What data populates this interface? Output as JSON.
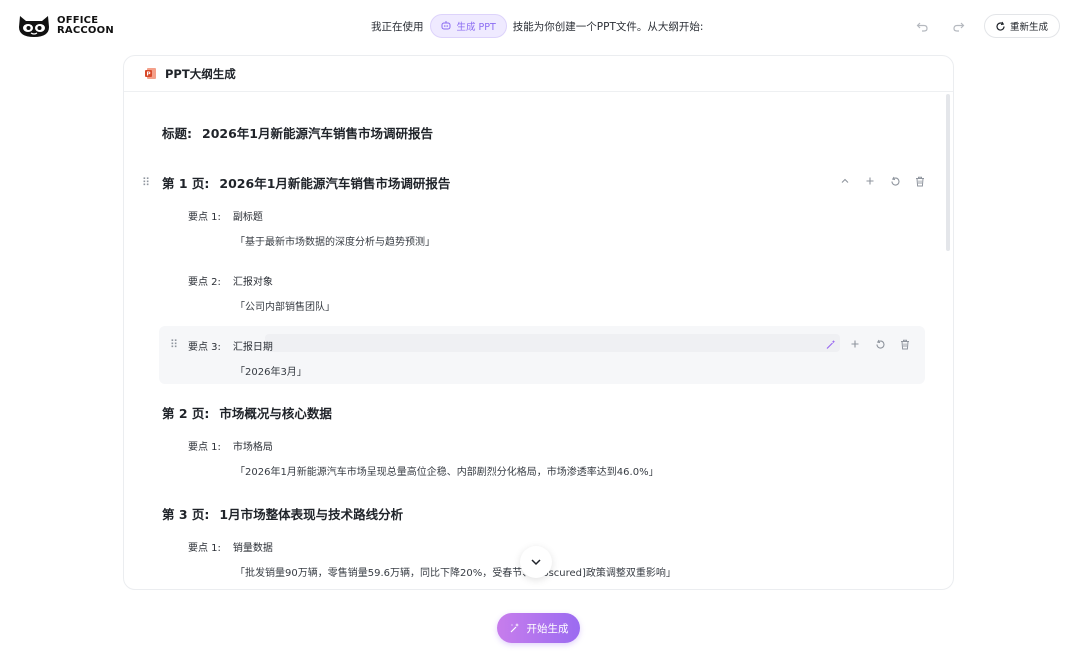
{
  "brand": {
    "line1": "OFFICE",
    "line2": "RACCOON"
  },
  "header": {
    "prefix": "我正在使用",
    "skill_label": "生成 PPT",
    "suffix": "技能为你创建一个PPT文件。从大纲开始:",
    "regen_label": "重新生成"
  },
  "panel": {
    "title": "PPT大纲生成",
    "doc_title_label": "标题:",
    "doc_title": "2026年1月新能源汽车销售市场调研报告"
  },
  "pages": [
    {
      "label": "第 1 页:",
      "title": "2026年1月新能源汽车销售市场调研报告",
      "points": [
        {
          "label": "要点 1:",
          "name": "副标题",
          "value": "「基于最新市场数据的深度分析与趋势预测」"
        },
        {
          "label": "要点 2:",
          "name": "汇报对象",
          "value": "「公司内部销售团队」"
        },
        {
          "label": "要点 3:",
          "name": "汇报日期",
          "value": "「2026年3月」"
        }
      ]
    },
    {
      "label": "第 2 页:",
      "title": "市场概况与核心数据",
      "points": [
        {
          "label": "要点 1:",
          "name": "市场格局",
          "value": "「2026年1月新能源汽车市场呈现总量高位企稳、内部剧烈分化格局，市场渗透率达到46.0%」"
        }
      ]
    },
    {
      "label": "第 3 页:",
      "title": "1月市场整体表现与技术路线分析",
      "points": [
        {
          "label": "要点 1:",
          "name": "销量数据",
          "value": "「批发销量90万辆，零售销量59.6万辆，同比下降20%，受春节、[obscured]政策调整双重影响」"
        }
      ]
    }
  ],
  "footer": {
    "start_label": "开始生成"
  },
  "colors": {
    "accent": "#9b6bf1",
    "accent_light": "#efeaff"
  }
}
